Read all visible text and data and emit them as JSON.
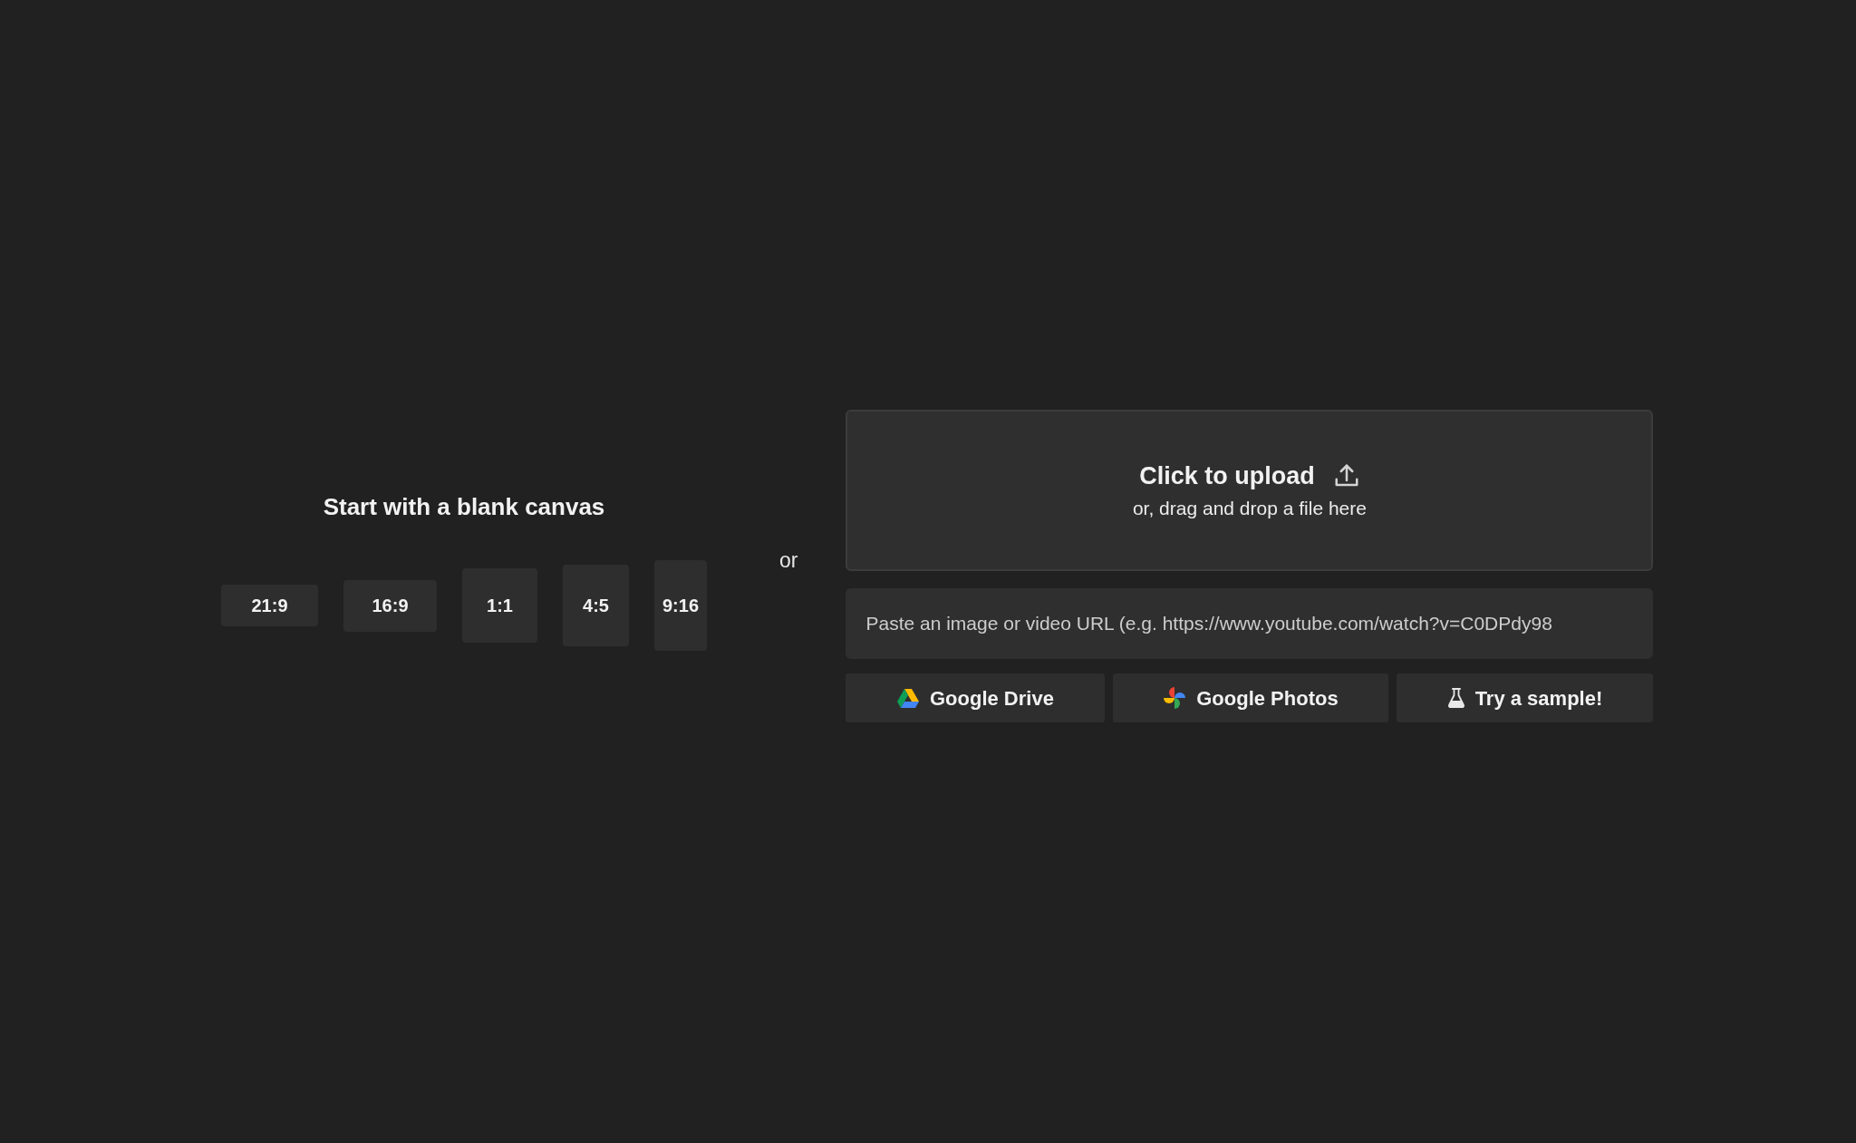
{
  "blank_canvas": {
    "title": "Start with a blank canvas",
    "aspect_ratios": [
      {
        "label": "21:9"
      },
      {
        "label": "16:9"
      },
      {
        "label": "1:1"
      },
      {
        "label": "4:5"
      },
      {
        "label": "9:16"
      }
    ]
  },
  "separator": "or",
  "upload": {
    "title": "Click to upload",
    "subtitle": "or, drag and drop a file here"
  },
  "url_field": {
    "placeholder": "Paste an image or video URL (e.g. https://www.youtube.com/watch?v=C0DPdy98"
  },
  "sources": [
    {
      "kind": "drive",
      "label": "Google Drive"
    },
    {
      "kind": "photos",
      "label": "Google Photos"
    },
    {
      "kind": "sample",
      "label": "Try a sample!"
    }
  ]
}
